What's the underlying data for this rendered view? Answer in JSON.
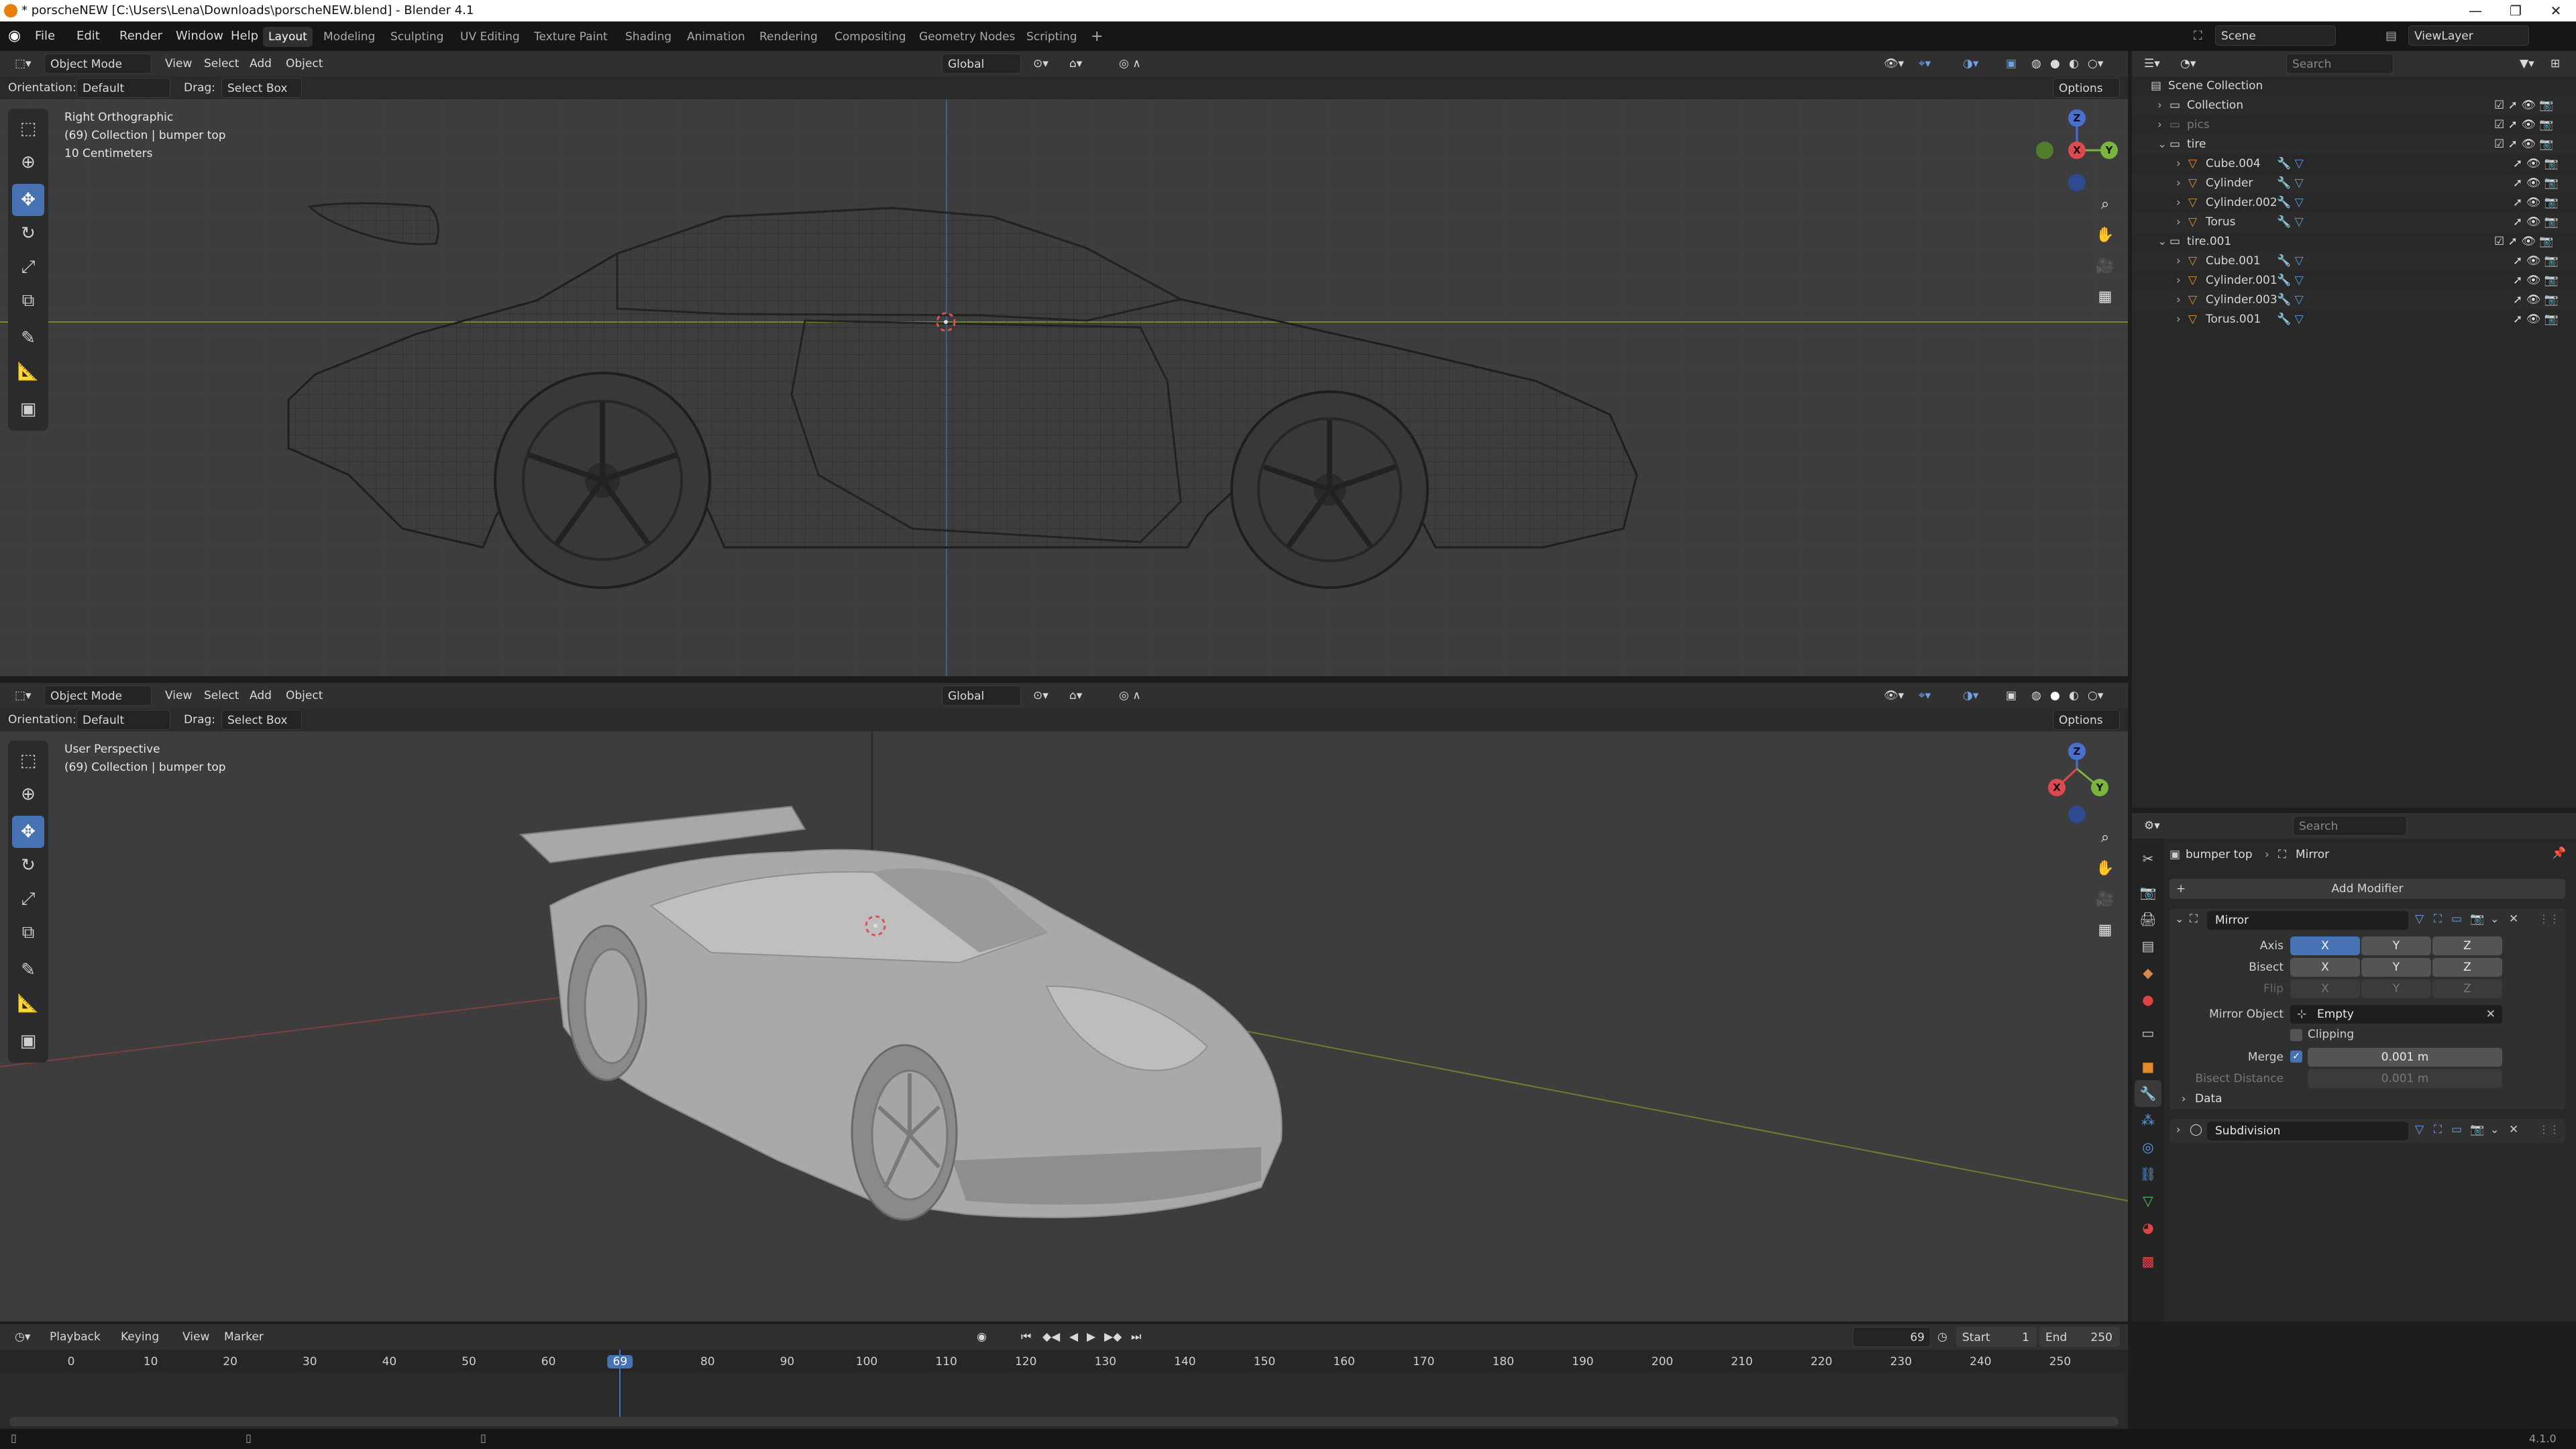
{
  "window": {
    "title": "* porscheNEW [C:\\Users\\Lena\\Downloads\\porscheNEW.blend] - Blender 4.1",
    "minimize": "—",
    "maximize": "❐",
    "close": "✕"
  },
  "menubar": {
    "items": [
      "File",
      "Edit",
      "Render",
      "Window",
      "Help"
    ],
    "workspaces": [
      "Layout",
      "Modeling",
      "Sculpting",
      "UV Editing",
      "Texture Paint",
      "Shading",
      "Animation",
      "Rendering",
      "Compositing",
      "Geometry Nodes",
      "Scripting"
    ],
    "active_workspace": "Layout",
    "add_tab": "+",
    "scene": "Scene",
    "view_layer": "ViewLayer"
  },
  "viewport_top": {
    "mode": "Object Mode",
    "menus": [
      "View",
      "Select",
      "Add",
      "Object"
    ],
    "transform_orientation": "Global",
    "options": "Options",
    "orientation_label": "Orientation:",
    "orientation_value": "Default",
    "drag_label": "Drag:",
    "drag_value": "Select Box",
    "info_view": "Right Orthographic",
    "info_collection": "(69) Collection | bumper top",
    "info_scale": "10 Centimeters"
  },
  "viewport_bottom": {
    "mode": "Object Mode",
    "menus": [
      "View",
      "Select",
      "Add",
      "Object"
    ],
    "transform_orientation": "Global",
    "options": "Options",
    "orientation_label": "Orientation:",
    "orientation_value": "Default",
    "drag_label": "Drag:",
    "drag_value": "Select Box",
    "info_view": "User Perspective",
    "info_collection": "(69) Collection | bumper top"
  },
  "gizmo": {
    "x": "X",
    "y": "Y",
    "z": "Z"
  },
  "outliner": {
    "search_placeholder": "Search",
    "rows": [
      {
        "label": "Scene Collection",
        "indent": 0,
        "type": "scene"
      },
      {
        "label": "Collection",
        "indent": 1,
        "type": "collection"
      },
      {
        "label": "pics",
        "indent": 1,
        "type": "collection-dim"
      },
      {
        "label": "tire",
        "indent": 1,
        "type": "collection"
      },
      {
        "label": "Cube.004",
        "indent": 2,
        "type": "mesh"
      },
      {
        "label": "Cylinder",
        "indent": 2,
        "type": "mesh"
      },
      {
        "label": "Cylinder.002",
        "indent": 2,
        "type": "mesh"
      },
      {
        "label": "Torus",
        "indent": 2,
        "type": "mesh"
      },
      {
        "label": "tire.001",
        "indent": 1,
        "type": "collection"
      },
      {
        "label": "Cube.001",
        "indent": 2,
        "type": "mesh"
      },
      {
        "label": "Cylinder.001",
        "indent": 2,
        "type": "mesh"
      },
      {
        "label": "Cylinder.003",
        "indent": 2,
        "type": "mesh"
      },
      {
        "label": "Torus.001",
        "indent": 2,
        "type": "mesh"
      }
    ]
  },
  "properties": {
    "search_placeholder": "Search",
    "breadcrumb_object": "bumper top",
    "breadcrumb_modifier": "Mirror",
    "add_modifier": "Add Modifier",
    "mirror": {
      "name": "Mirror",
      "axis_label": "Axis",
      "bisect_label": "Bisect",
      "flip_label": "Flip",
      "x": "X",
      "y": "Y",
      "z": "Z",
      "mirror_object_label": "Mirror Object",
      "mirror_object_value": "Empty",
      "clipping_label": "Clipping",
      "merge_label": "Merge",
      "merge_value": "0.001 m",
      "bisect_distance_label": "Bisect Distance",
      "bisect_distance_value": "0.001 m",
      "data_label": "Data"
    },
    "subdivision": {
      "name": "Subdivision"
    }
  },
  "timeline": {
    "menus": [
      "Playback",
      "Keying",
      "View",
      "Marker"
    ],
    "current_frame": "69",
    "start_label": "Start",
    "start_value": "1",
    "end_label": "End",
    "end_value": "250",
    "ticks": [
      "0",
      "10",
      "20",
      "30",
      "40",
      "50",
      "60",
      "69",
      "80",
      "90",
      "100",
      "110",
      "120",
      "130",
      "140",
      "150",
      "160",
      "170",
      "180",
      "190",
      "200",
      "210",
      "220",
      "230",
      "240",
      "250"
    ]
  },
  "statusbar": {
    "version": "4.1.0"
  }
}
